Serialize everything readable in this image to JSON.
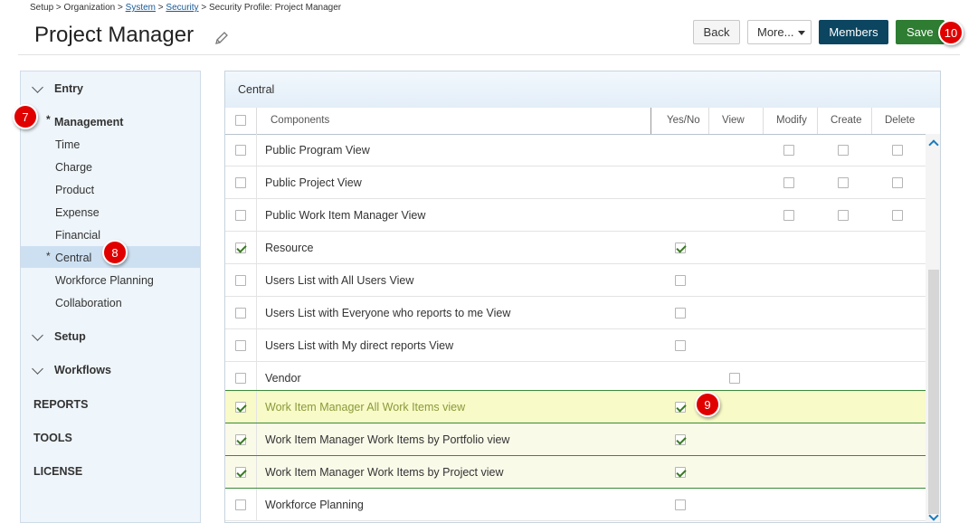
{
  "breadcrumb": {
    "root": "Setup",
    "org": "Organization",
    "system": "System",
    "security": "Security",
    "current": "Security Profile: Project Manager",
    "sep": ">"
  },
  "page": {
    "title": "Project Manager"
  },
  "toolbar": {
    "back": "Back",
    "more": "More...",
    "members": "Members",
    "save": "Save"
  },
  "badges": {
    "b7": "7",
    "b8": "8",
    "b9": "9",
    "b10": "10"
  },
  "sidebar": {
    "entry": "Entry",
    "management": "Management",
    "mgmt_items": [
      "Time",
      "Charge",
      "Product",
      "Expense",
      "Financial",
      "Central",
      "Workforce Planning",
      "Collaboration"
    ],
    "setup": "Setup",
    "workflows": "Workflows",
    "reports": "REPORTS",
    "tools": "TOOLS",
    "license": "LICENSE",
    "star": "*"
  },
  "panel": {
    "title": "Central",
    "columns": {
      "components": "Components",
      "yesno": "Yes/No",
      "view": "View",
      "modify": "Modify",
      "create": "Create",
      "delete": "Delete"
    },
    "rows": [
      {
        "label": "Public Program View"
      },
      {
        "label": "Public Project View"
      },
      {
        "label": "Public Work Item Manager View"
      },
      {
        "label": "Resource"
      },
      {
        "label": "Users List with All Users View"
      },
      {
        "label": "Users List with Everyone who reports to me View"
      },
      {
        "label": "Users List with My direct reports View"
      },
      {
        "label": "Vendor"
      },
      {
        "label": "Work Item Manager All Work Items view"
      },
      {
        "label": "Work Item Manager Work Items by Portfolio view"
      },
      {
        "label": "Work Item Manager Work Items by Project view"
      },
      {
        "label": "Workforce Planning"
      }
    ]
  },
  "colors": {
    "accent_red": "#e00000",
    "members_bg": "#0b4560",
    "save_bg": "#2e7d32"
  }
}
